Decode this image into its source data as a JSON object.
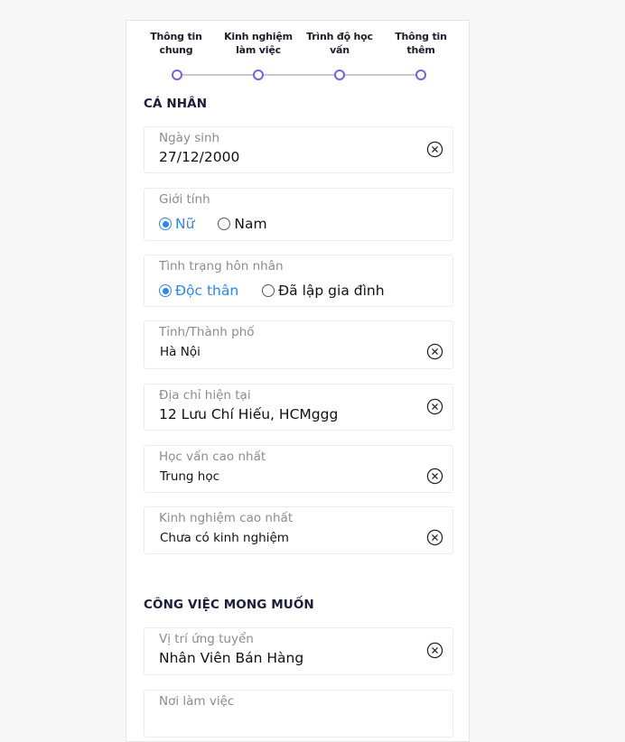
{
  "steps": [
    {
      "label": "Thông tin chung"
    },
    {
      "label": "Kinh nghiệm làm việc"
    },
    {
      "label": "Trình độ học vấn"
    },
    {
      "label": "Thông tin thêm"
    }
  ],
  "colors": {
    "accent": "#7b5fd3",
    "radio_selected": "#2f86eb",
    "section_title": "#1b1d3a"
  },
  "personal": {
    "section_title": "CÁ NHÂN",
    "birth_date": {
      "label": "Ngày sinh",
      "value": "27/12/2000"
    },
    "gender": {
      "label": "Giới tính",
      "options": [
        "Nữ",
        "Nam"
      ],
      "selected": "Nữ"
    },
    "marital": {
      "label": "Tình trạng hôn nhân",
      "options": [
        "Độc thân",
        "Đã lập gia đình"
      ],
      "selected": "Độc thân"
    },
    "city": {
      "label": "Tỉnh/Thành phố",
      "value": "Hà Nội"
    },
    "address": {
      "label": "Địa chỉ hiện tại",
      "value": "12 Lưu Chí Hiếu, HCMggg"
    },
    "education": {
      "label": "Học vấn cao nhất",
      "value": "Trung học"
    },
    "experience": {
      "label": "Kinh nghiệm cao nhất",
      "value": "Chưa có kinh nghiệm"
    }
  },
  "desired_job": {
    "section_title": "CÔNG VIỆC MONG MUỐN",
    "position": {
      "label": "Vị trí ứng tuyển",
      "value": "Nhân Viên Bán Hàng"
    },
    "workplace": {
      "label": "Nơi làm việc"
    }
  },
  "icons": {
    "clear": "circle-x-icon"
  }
}
